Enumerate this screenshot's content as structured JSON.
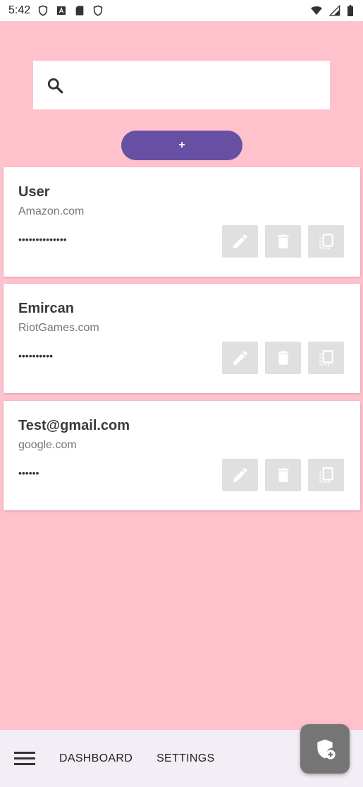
{
  "status_bar": {
    "time": "5:42",
    "left_icons": [
      "shield-icon",
      "font-icon",
      "sd-card-icon",
      "shield-icon"
    ],
    "right_icons": [
      "wifi-icon",
      "signal-icon",
      "battery-icon"
    ]
  },
  "search": {
    "placeholder": "",
    "value": ""
  },
  "add_button": {
    "label": "+"
  },
  "entries": [
    {
      "username": "User",
      "site": "Amazon.com",
      "password_mask": "••••••••••••••"
    },
    {
      "username": "Emircan",
      "site": "RiotGames.com",
      "password_mask": "••••••••••"
    },
    {
      "username": "Test@gmail.com",
      "site": "google.com",
      "password_mask": "••••••"
    }
  ],
  "bottom_bar": {
    "nav": [
      {
        "label": "DASHBOARD"
      },
      {
        "label": "SETTINGS"
      }
    ]
  },
  "colors": {
    "background": "#ffc1cc",
    "accent": "#6750a4",
    "action_button": "#e0e0e0",
    "fab": "#757575"
  }
}
